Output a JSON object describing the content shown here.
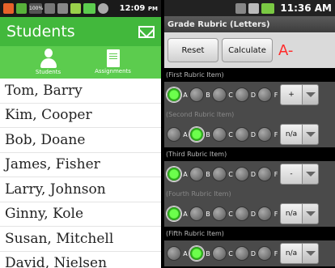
{
  "left": {
    "status": {
      "time": "12:09",
      "ampm": "PM",
      "battery": "100%"
    },
    "title": "Students",
    "tabs": [
      {
        "label": "Students",
        "icon": "person-icon"
      },
      {
        "label": "Assignments",
        "icon": "document-icon"
      }
    ],
    "students": [
      "Tom, Barry",
      "Kim, Cooper",
      "Bob, Doane",
      "James, Fisher",
      "Larry, Johnson",
      "Ginny, Kole",
      "Susan, Mitchell",
      "David, Nielsen"
    ]
  },
  "right": {
    "status": {
      "time": "11:36 AM"
    },
    "title": "Grade Rubric (Letters)",
    "reset_label": "Reset",
    "calculate_label": "Calculate",
    "result_grade": "A-",
    "grade_letters": [
      "A",
      "B",
      "C",
      "D",
      "F"
    ],
    "items": [
      {
        "label": "(First Rubric Item)",
        "selected": "A",
        "modifier": "+"
      },
      {
        "label": "(Second Rubric Item)",
        "selected": "B",
        "modifier": "n/a"
      },
      {
        "label": "(Third Rubric Item)",
        "selected": "A",
        "modifier": "-"
      },
      {
        "label": "(Fourth Rubric Item)",
        "selected": "A",
        "modifier": "n/a"
      },
      {
        "label": "(Fifth Rubric Item)",
        "selected": "B",
        "modifier": "n/a"
      }
    ]
  },
  "colors": {
    "title_green": "#42b83c",
    "tab_green": "#5ccc4e",
    "grade_red": "#ff2b2b",
    "radio_selected": "#4cff2c"
  }
}
